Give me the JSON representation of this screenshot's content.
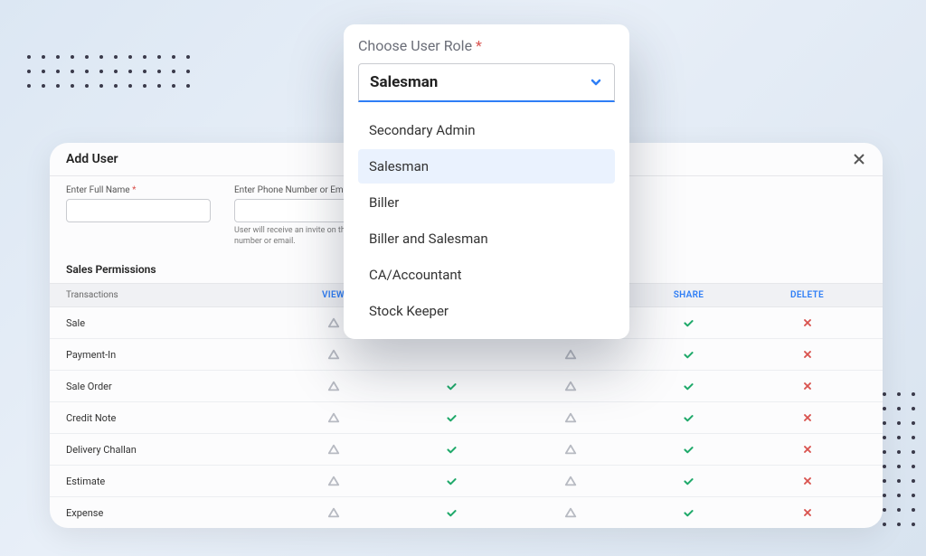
{
  "modal": {
    "title": "Add User",
    "fullNameLabel": "Enter Full Name",
    "phoneLabel": "Enter Phone Number or Email",
    "hint": "User will receive an invite on this number or email.",
    "fullName": "",
    "phone": ""
  },
  "permissions": {
    "title": "Sales Permissions",
    "headers": {
      "transactions": "Transactions",
      "view": "VIEW",
      "add": "",
      "edit": "",
      "share": "SHARE",
      "delete": "DELETE"
    },
    "rows": [
      {
        "name": "Sale",
        "view": "tri",
        "add": "",
        "edit": "",
        "share": "chk",
        "delete": "x"
      },
      {
        "name": "Payment-In",
        "view": "tri",
        "add": "",
        "edit": "tri",
        "share": "chk",
        "delete": "x"
      },
      {
        "name": "Sale Order",
        "view": "tri",
        "add": "chk",
        "edit": "tri",
        "share": "chk",
        "delete": "x"
      },
      {
        "name": "Credit Note",
        "view": "tri",
        "add": "chk",
        "edit": "tri",
        "share": "chk",
        "delete": "x"
      },
      {
        "name": "Delivery Challan",
        "view": "tri",
        "add": "chk",
        "edit": "tri",
        "share": "chk",
        "delete": "x"
      },
      {
        "name": "Estimate",
        "view": "tri",
        "add": "chk",
        "edit": "tri",
        "share": "chk",
        "delete": "x"
      },
      {
        "name": "Expense",
        "view": "tri",
        "add": "chk",
        "edit": "tri",
        "share": "chk",
        "delete": "x"
      }
    ]
  },
  "dropdown": {
    "label": "Choose User Role",
    "selected": "Salesman",
    "options": [
      "Secondary Admin",
      "Salesman",
      "Biller",
      "Biller and Salesman",
      "CA/Accountant",
      "Stock Keeper"
    ]
  }
}
